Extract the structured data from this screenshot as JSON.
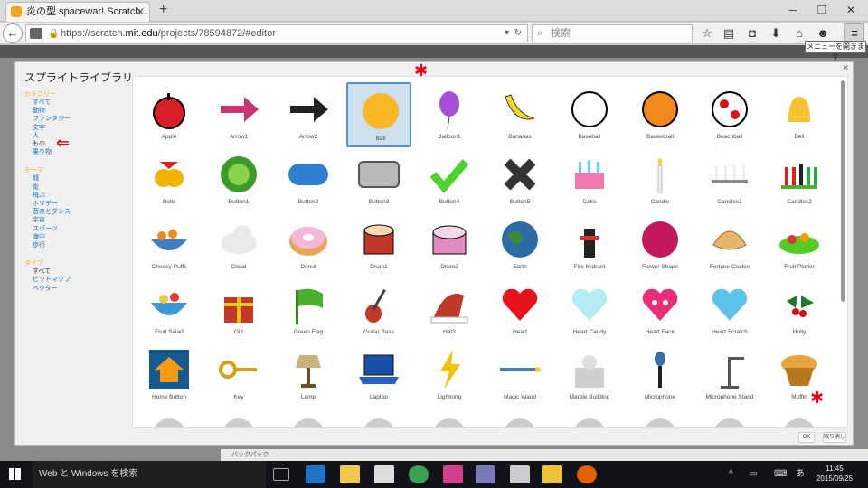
{
  "browser": {
    "tab_title": "炎の型 spacewar! Scratch...",
    "url_host": "https://scratch.",
    "url_domain": "mit.edu",
    "url_path": "/projects/78594872/#editor",
    "search_placeholder": "検索",
    "menu_tooltip": "メニューを開きます"
  },
  "dialog": {
    "title": "スプライトライブラリー",
    "sections": [
      {
        "heading": "カテゴリー",
        "items": [
          "すべて",
          "動物",
          "ファンタジー",
          "文字",
          "人",
          "もの",
          "乗り物"
        ],
        "selected": "もの"
      },
      {
        "heading": "テーマ",
        "items": [
          "城",
          "街",
          "飛ぶ",
          "ホリデー",
          "音楽とダンス",
          "宇宙",
          "スポーツ",
          "海中",
          "歩行"
        ],
        "selected": ""
      },
      {
        "heading": "タイプ",
        "items": [
          "すべて",
          "ビットマップ",
          "ベクター"
        ],
        "selected": "すべて"
      }
    ],
    "ok_label": "OK",
    "cancel_label": "取り消し",
    "selected_sprite": "Ball",
    "sprites": [
      "Apple",
      "Arrow1",
      "Arrow2",
      "Ball",
      "Balloon1",
      "Bananas",
      "Baseball",
      "Basketball",
      "Beachball",
      "Bell",
      "Bells",
      "Button1",
      "Button2",
      "Button3",
      "Button4",
      "Button5",
      "Cake",
      "Candle",
      "Candles1",
      "Candles2",
      "Cheesy-Puffs",
      "Cloud",
      "Donut",
      "Drum1",
      "Drum2",
      "Earth",
      "Fire hydrant",
      "Flower Shape",
      "Fortune Cookie",
      "Fruit Platter",
      "Fruit Salad",
      "Gift",
      "Green Flag",
      "Guitar Bass",
      "Hat3",
      "Heart",
      "Heart Candy",
      "Heart Face",
      "Heart Scratch",
      "Holly",
      "Home Button",
      "Key",
      "Lamp",
      "Laptop",
      "Lightning",
      "Magic Wand",
      "Marble Building",
      "Microphone",
      "Microphone Stand",
      "Muffin"
    ]
  },
  "scratch_bottom": "バックパック",
  "taskbar": {
    "search_text": "Web と Windows を検索",
    "ime": "あ",
    "time": "11:45",
    "date": "2015/09/25"
  }
}
